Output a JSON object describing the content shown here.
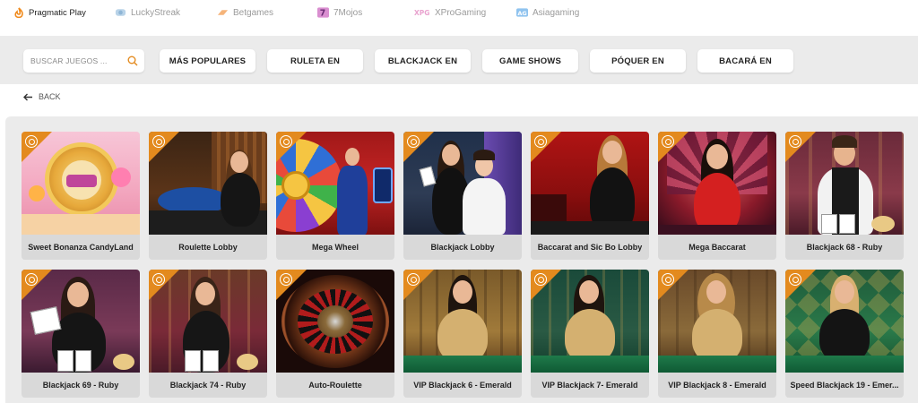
{
  "providers": [
    {
      "name": "Pragmatic Play",
      "icon": "pragmatic-icon",
      "active": true
    },
    {
      "name": "LuckyStreak",
      "icon": "luckystreak-icon",
      "active": false
    },
    {
      "name": "Betgames",
      "icon": "betgames-icon",
      "active": false
    },
    {
      "name": "7Mojos",
      "icon": "7mojos-icon",
      "active": false
    },
    {
      "name": "XProGaming",
      "icon": "xprogaming-icon",
      "active": false
    },
    {
      "name": "Asiagaming",
      "icon": "asiagaming-icon",
      "active": false
    }
  ],
  "search": {
    "placeholder": "BUSCAR JUEGOS ..."
  },
  "filters": [
    "MÁS POPULARES",
    "RULETA EN",
    "BLACKJACK EN",
    "GAME SHOWS",
    "PÓQUER EN",
    "BACARÁ EN"
  ],
  "back_label": "BACK",
  "colors": {
    "accent": "#e38a1e",
    "band": "#ebebeb",
    "card_label_bg": "#d9d9d9"
  },
  "games_row1": [
    "Sweet Bonanza CandyLand",
    "Roulette Lobby",
    "Mega Wheel",
    "Blackjack Lobby",
    "Baccarat and Sic Bo Lobby",
    "Mega Baccarat",
    "Blackjack 68 - Ruby"
  ],
  "games_row2": [
    "Blackjack 69 - Ruby",
    "Blackjack 74 - Ruby",
    "Auto-Roulette",
    "VIP Blackjack 6 - Emerald",
    "VIP Blackjack 7- Emerald",
    "VIP Blackjack 8 - Emerald",
    "Speed Blackjack 19 - Emer..."
  ]
}
